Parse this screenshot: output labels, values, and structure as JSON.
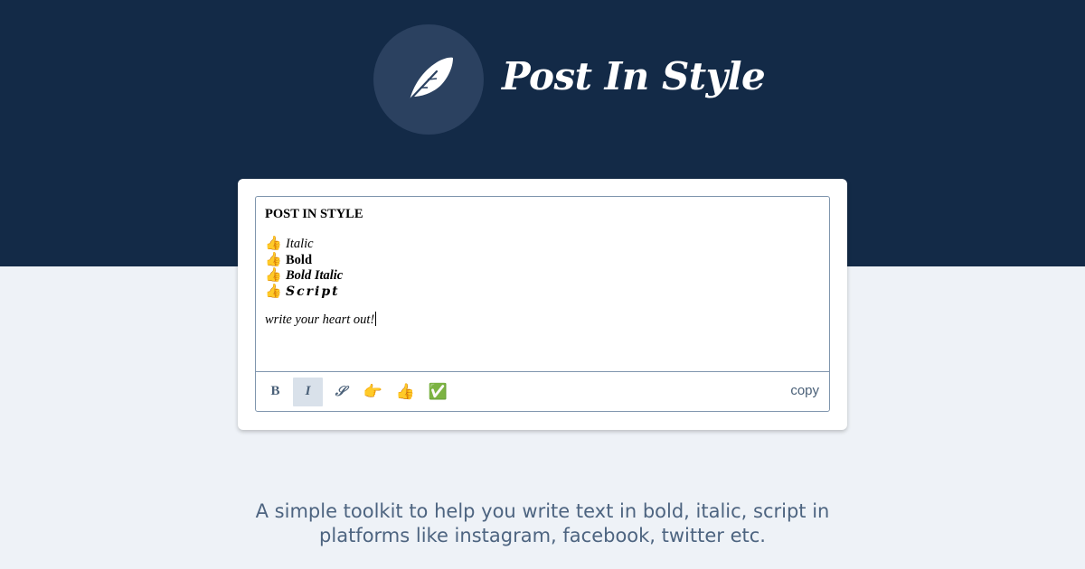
{
  "brand": {
    "title": "Post In Style",
    "logo_icon": "feather-icon"
  },
  "colors": {
    "hero_background": "#132a47",
    "page_background": "#eef2f7",
    "logo_circle": "#2b4160",
    "toolbar_text": "#4a6078",
    "tagline_text": "#4d6480",
    "active_button": "#d9e1ea"
  },
  "editor": {
    "heading": "POST IN STYLE",
    "lines": [
      {
        "bullet": "👍",
        "text": "Italic",
        "style": "italic"
      },
      {
        "bullet": "👍",
        "text": "Bold",
        "style": "bold"
      },
      {
        "bullet": "👍",
        "text": "Bold Italic",
        "style": "bold-italic"
      },
      {
        "bullet": "👍",
        "text": "Script",
        "style": "script"
      }
    ],
    "closing_text": "write your heart out!"
  },
  "toolbar": {
    "buttons": [
      {
        "label": "B",
        "name": "bold-button",
        "active": false
      },
      {
        "label": "I",
        "name": "italic-button",
        "active": true
      },
      {
        "label": "𝒮",
        "name": "script-button",
        "active": false
      },
      {
        "label": "👉",
        "name": "pointing-hand-button",
        "active": false
      },
      {
        "label": "👍",
        "name": "thumbs-up-button",
        "active": false
      },
      {
        "label": "✅",
        "name": "check-mark-button",
        "active": false
      }
    ],
    "copy_label": "copy"
  },
  "tagline": {
    "line1": "A simple toolkit to help you write text in bold, italic, script in",
    "line2": "platforms like instagram, facebook, twitter etc."
  }
}
